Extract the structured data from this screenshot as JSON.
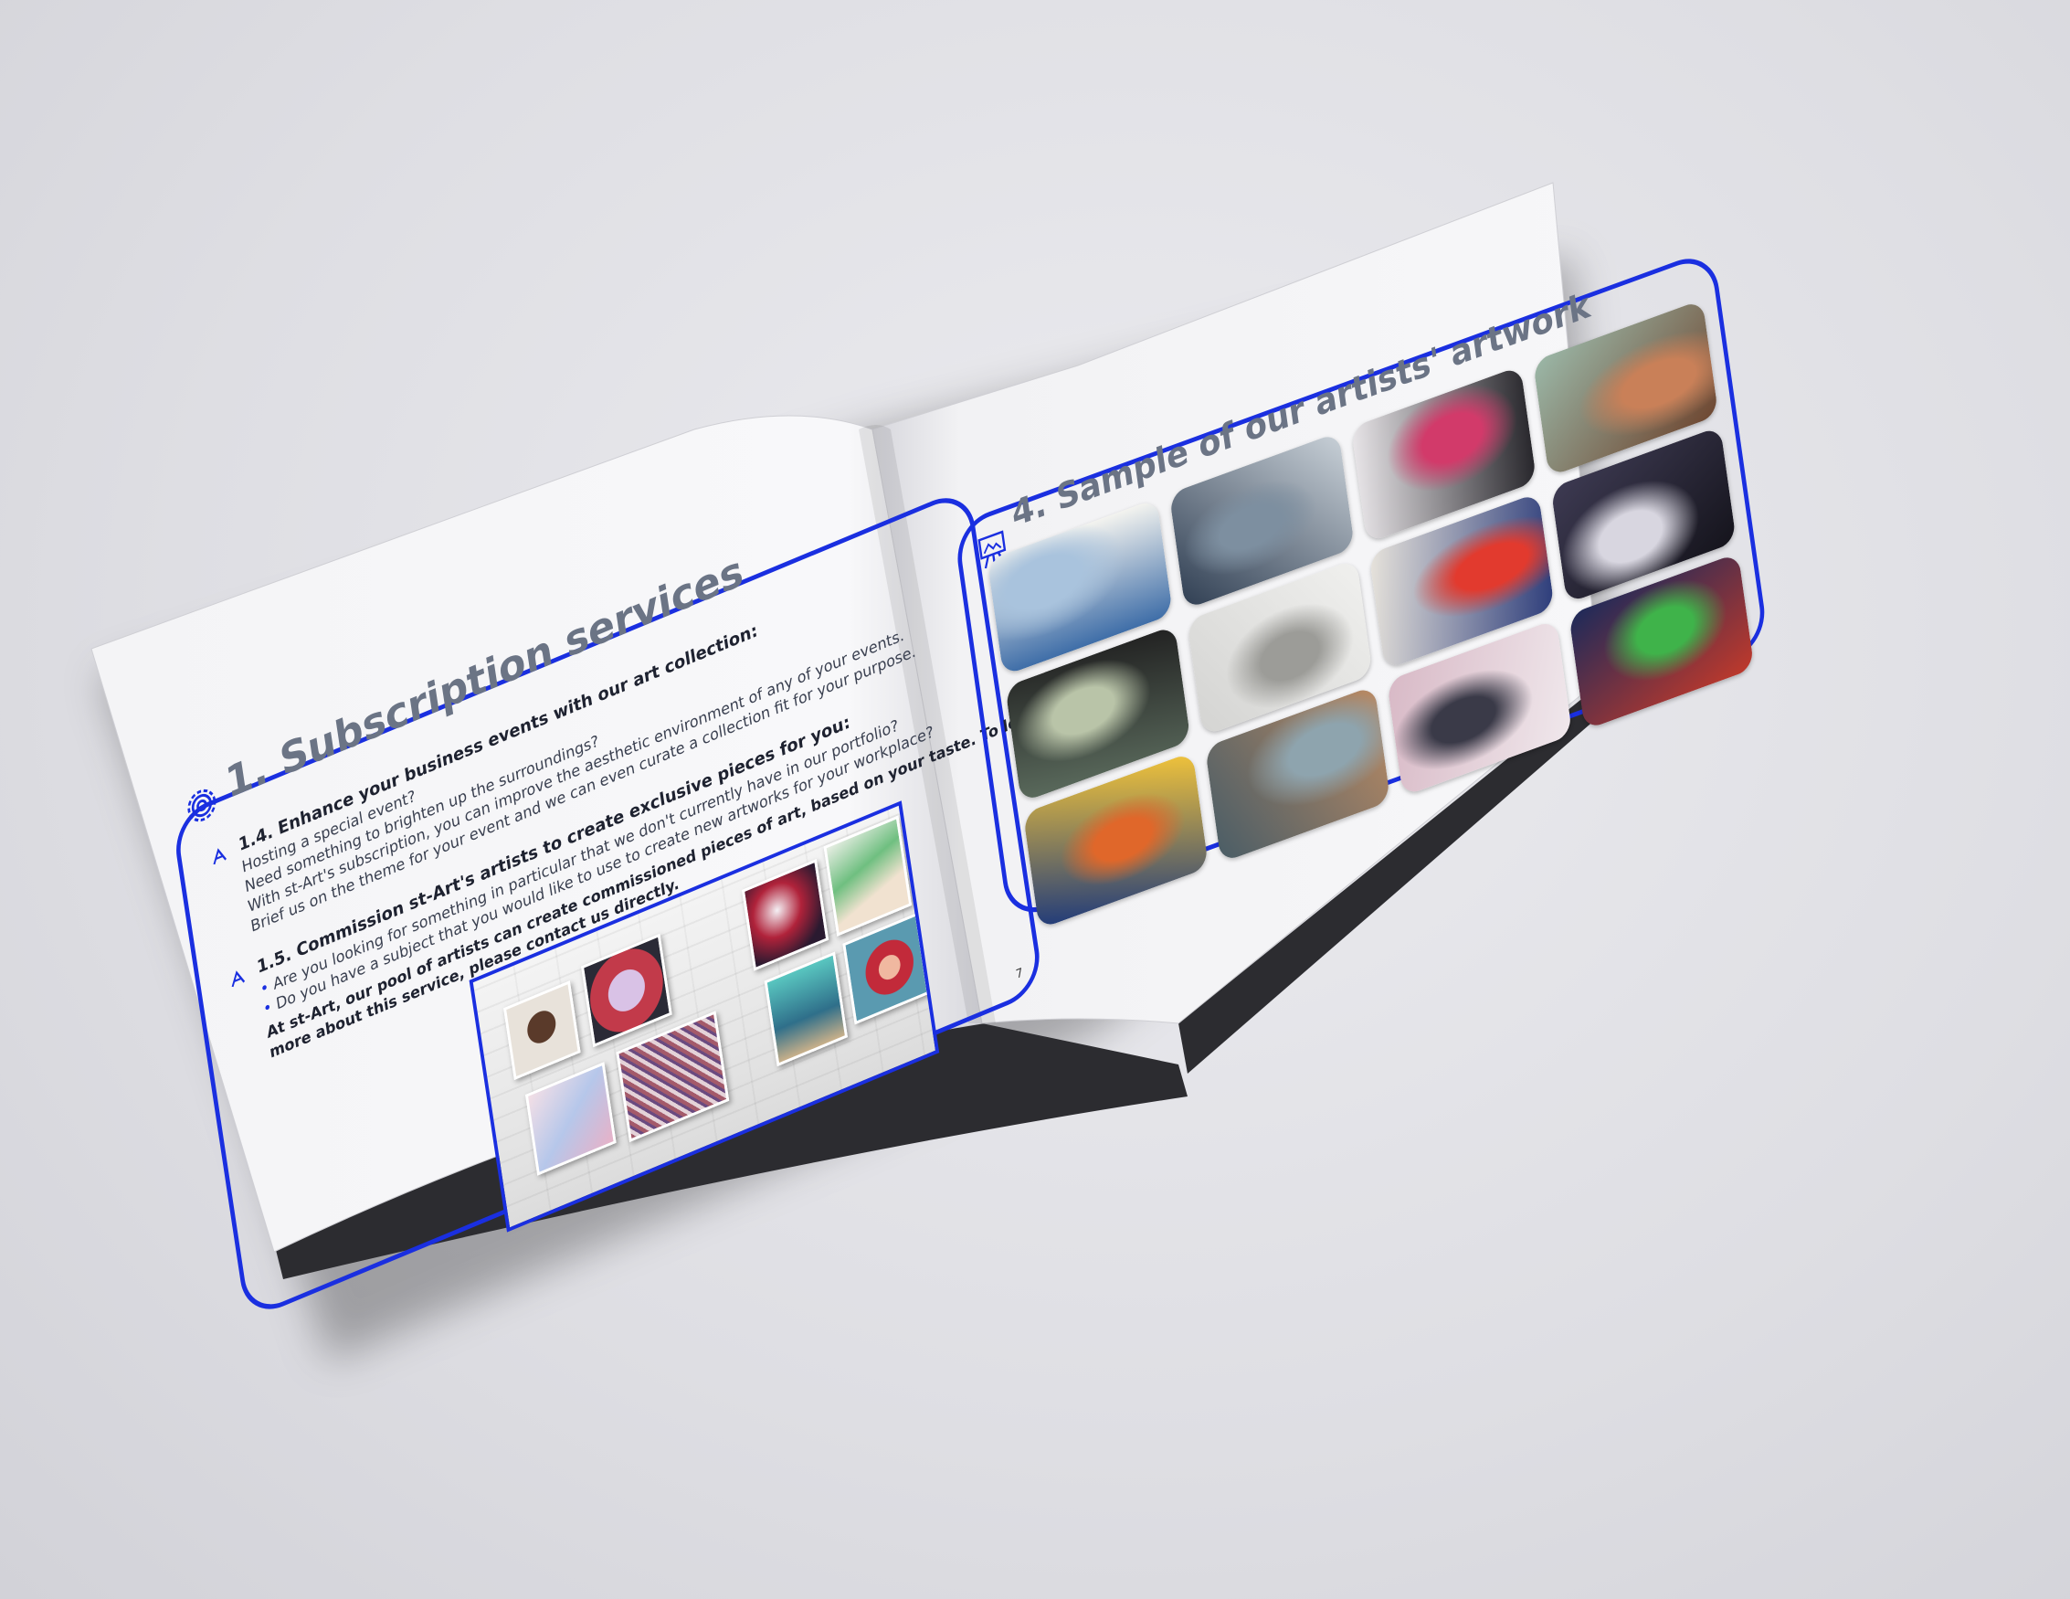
{
  "left_page": {
    "title": "1. Subscription services",
    "section_1_4": {
      "heading": "1.4. Enhance your business events with our art collection:",
      "lines": [
        "Hosting a special event?",
        "Need something to brighten up the surroundings?",
        "With st-Art's subscription, you can improve the aesthetic environment of any of your events.",
        "Brief us on the theme for your event and we can even curate a collection fit for your purpose."
      ]
    },
    "section_1_5": {
      "heading": "1.5. Commission st-Art's artists to create exclusive pieces for you:",
      "bullets": [
        "Are you looking for something in particular that we don't currently have in our portfolio?",
        "Do you have a subject that you would like to use to create new artworks for your workplace?"
      ],
      "closing_1": "At st-Art, our pool of artists can create commissioned pieces of art, based on your taste. To learn",
      "closing_2": "more about this service, please contact us directly."
    },
    "page_number": "7",
    "icon": "gear-icon"
  },
  "right_page": {
    "title": "4. Sample of our artists' artwork",
    "icon": "easel-icon",
    "tiles": [
      {
        "name": "rhino-painting",
        "colors": [
          "#3f6ea8",
          "#a9c3dd",
          "#f3f3ef"
        ]
      },
      {
        "name": "harbor-painting",
        "colors": [
          "#2f3e52",
          "#7d8fa0",
          "#c9d1d8"
        ]
      },
      {
        "name": "dancer-painting",
        "colors": [
          "#e8e5e8",
          "#d23a6a",
          "#27262b"
        ]
      },
      {
        "name": "portrait-man-painting",
        "colors": [
          "#9bb8a8",
          "#c98058",
          "#6e4630"
        ]
      },
      {
        "name": "woman-green-dress-painting",
        "colors": [
          "#5a6a5c",
          "#b9c4a8",
          "#222"
        ]
      },
      {
        "name": "sculpture-photo",
        "colors": [
          "#d4d4d2",
          "#9c9c98",
          "#f0f0ee"
        ]
      },
      {
        "name": "circle-face-painting",
        "colors": [
          "#e8e4dc",
          "#e23a2e",
          "#2c3c7a"
        ]
      },
      {
        "name": "bw-face-painting",
        "colors": [
          "#3d3a52",
          "#d8d6e0",
          "#15141c"
        ]
      },
      {
        "name": "colorful-abstract-painting",
        "colors": [
          "#1f3a7a",
          "#e0672a",
          "#f2c43a"
        ]
      },
      {
        "name": "machinery-photo",
        "colors": [
          "#4a5d66",
          "#8ea4ae",
          "#b98a64"
        ]
      },
      {
        "name": "pink-street-painting",
        "colors": [
          "#d8b9c6",
          "#3a3a48",
          "#f0e8ec"
        ]
      },
      {
        "name": "cactus-painting",
        "colors": [
          "#1d2a5a",
          "#3fb34a",
          "#c0392b"
        ]
      }
    ]
  },
  "brand": {
    "accent": "#1a2fe0",
    "title_gray": "#6b7485"
  }
}
